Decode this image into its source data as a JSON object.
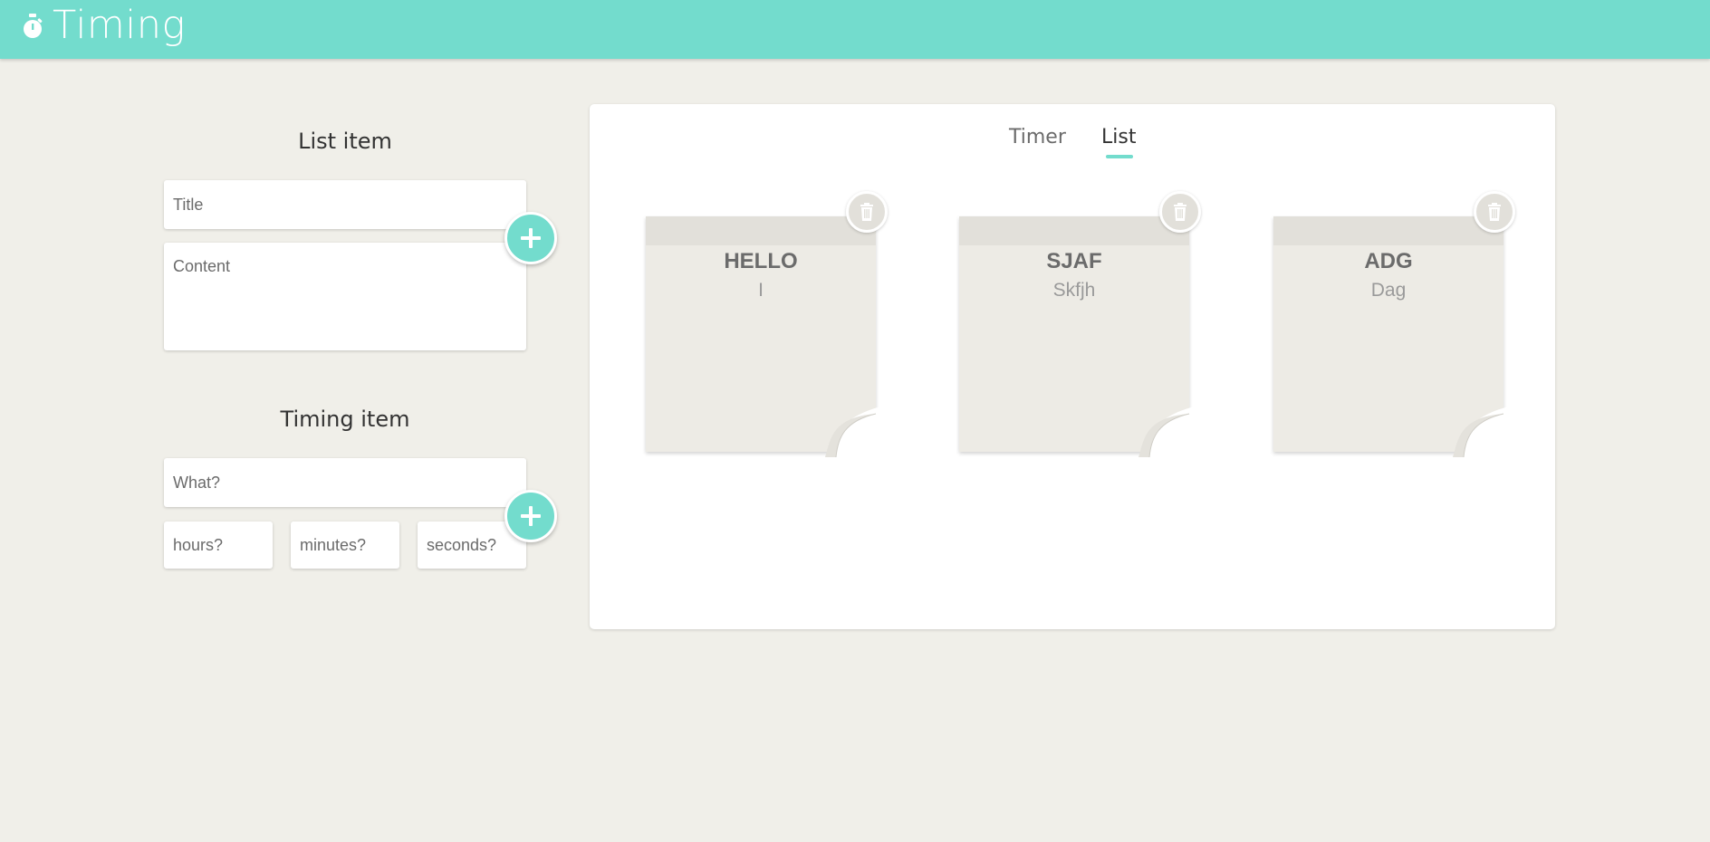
{
  "app": {
    "title": "Timing",
    "accent_color": "#73dccd",
    "background_color": "#f0efe9",
    "logo_icon": "stopwatch-icon"
  },
  "list_form": {
    "heading": "List item",
    "title_placeholder": "Title",
    "content_placeholder": "Content",
    "add_icon": "plus-icon"
  },
  "timing_form": {
    "heading": "Timing item",
    "what_placeholder": "What?",
    "hours_placeholder": "hours?",
    "minutes_placeholder": "minutes?",
    "seconds_placeholder": "seconds?",
    "add_icon": "plus-icon"
  },
  "tabs": [
    {
      "label": "Timer",
      "active": false
    },
    {
      "label": "List",
      "active": true
    }
  ],
  "notes": [
    {
      "title": "HELLO",
      "content": "I",
      "delete_icon": "trash-icon"
    },
    {
      "title": "SJAF",
      "content": "Skfjh",
      "delete_icon": "trash-icon"
    },
    {
      "title": "ADG",
      "content": "Dag",
      "delete_icon": "trash-icon"
    }
  ]
}
